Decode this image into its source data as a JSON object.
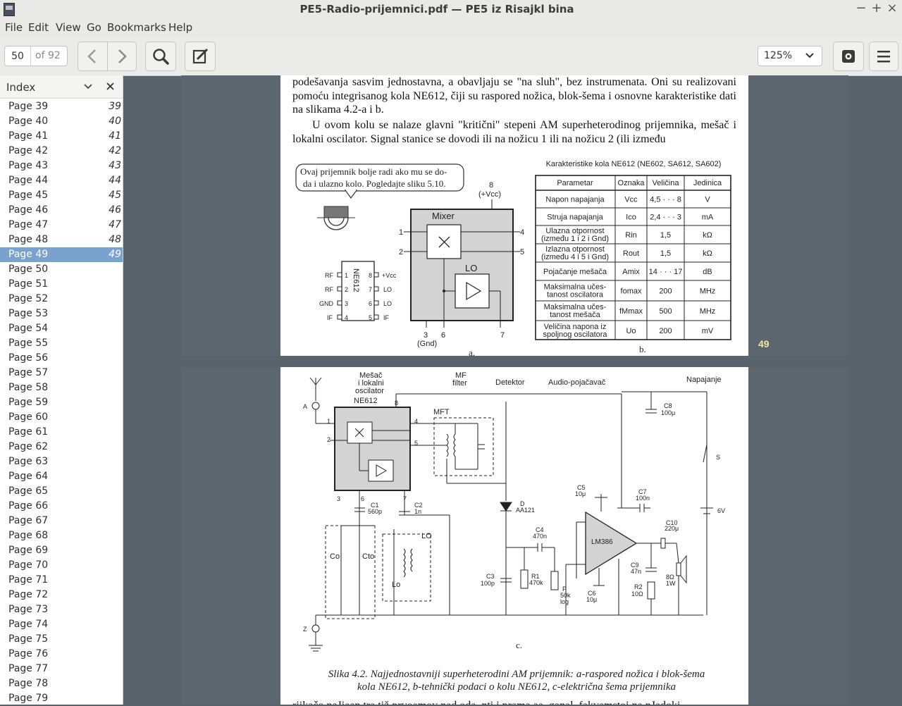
{
  "window": {
    "title": "PE5-Radio-prijemnici.pdf — PE5 iz Risajkl bina",
    "minimize": "−",
    "maximize": "+",
    "close": "×"
  },
  "menu": [
    "File",
    "Edit",
    "View",
    "Go",
    "Bookmarks",
    "Help"
  ],
  "toolbar": {
    "page_value": "50",
    "page_total": "of 92",
    "zoom": "125%"
  },
  "sidebar": {
    "title": "Index",
    "selected": "Page 49",
    "items": [
      {
        "label": "Page 39",
        "num": "39"
      },
      {
        "label": "Page 40",
        "num": "40"
      },
      {
        "label": "Page 41",
        "num": "41"
      },
      {
        "label": "Page 42",
        "num": "42"
      },
      {
        "label": "Page 43",
        "num": "43"
      },
      {
        "label": "Page 44",
        "num": "44"
      },
      {
        "label": "Page 45",
        "num": "45"
      },
      {
        "label": "Page 46",
        "num": "46"
      },
      {
        "label": "Page 47",
        "num": "47"
      },
      {
        "label": "Page 48",
        "num": "48"
      },
      {
        "label": "Page 49",
        "num": "49"
      },
      {
        "label": "Page 50",
        "num": ""
      },
      {
        "label": "Page 51",
        "num": ""
      },
      {
        "label": "Page 52",
        "num": ""
      },
      {
        "label": "Page 53",
        "num": ""
      },
      {
        "label": "Page 54",
        "num": ""
      },
      {
        "label": "Page 55",
        "num": ""
      },
      {
        "label": "Page 56",
        "num": ""
      },
      {
        "label": "Page 57",
        "num": ""
      },
      {
        "label": "Page 58",
        "num": ""
      },
      {
        "label": "Page 59",
        "num": ""
      },
      {
        "label": "Page 60",
        "num": ""
      },
      {
        "label": "Page 61",
        "num": ""
      },
      {
        "label": "Page 62",
        "num": ""
      },
      {
        "label": "Page 63",
        "num": ""
      },
      {
        "label": "Page 64",
        "num": ""
      },
      {
        "label": "Page 65",
        "num": ""
      },
      {
        "label": "Page 66",
        "num": ""
      },
      {
        "label": "Page 67",
        "num": ""
      },
      {
        "label": "Page 68",
        "num": ""
      },
      {
        "label": "Page 69",
        "num": ""
      },
      {
        "label": "Page 70",
        "num": ""
      },
      {
        "label": "Page 71",
        "num": ""
      },
      {
        "label": "Page 72",
        "num": ""
      },
      {
        "label": "Page 73",
        "num": ""
      },
      {
        "label": "Page 74",
        "num": ""
      },
      {
        "label": "Page 75",
        "num": ""
      },
      {
        "label": "Page 76",
        "num": ""
      },
      {
        "label": "Page 77",
        "num": ""
      },
      {
        "label": "Page 78",
        "num": ""
      },
      {
        "label": "Page 79",
        "num": ""
      }
    ]
  },
  "page49": {
    "para1": "podešavanja sasvim jednostavna, a obavljaju se \"na sluh\", bez instrumenata. Oni su realizovani pomoću integrisanog kola NE612, čiji su raspored nožica, blok-šema i osnovne karakteristike dati na slikama 4.2-a i b.",
    "para2": "U ovom kolu se nalaze glavni \"kritični\" stepeni AM superheterodinog prijemnika, mešač i lokalni oscilator. Signal stanice se dovodi ili na nožicu 1 ili na nožicu 2 (ili između",
    "bubble1": "Ovaj prijemnik bolje radi ako mu se do-",
    "bubble2": "da i ulazno kolo. Pogledajte sliku 5.10.",
    "fig_a": {
      "vcc_pin": "8",
      "vcc_label": "(+Vcc)",
      "mixer": "Mixer",
      "lo": "LO",
      "pin1": "1",
      "pin2": "2",
      "pin4": "4",
      "pin5": "5",
      "pin3": "3",
      "pin6": "6",
      "pin7": "7",
      "gnd": "(Gnd)",
      "chip": "NE612",
      "left_labels": [
        "RF",
        "RF",
        "GND",
        "IF"
      ],
      "left_pins": [
        "1",
        "2",
        "3",
        "4"
      ],
      "right_pins": [
        "8",
        "7",
        "6",
        "5"
      ],
      "right_labels": [
        "+Vcc",
        "LO",
        "LO",
        "IF"
      ],
      "label": "a."
    },
    "table": {
      "title": "Karakteristike kola NE612 (NE602, SA612, SA602)",
      "headers": [
        "Parametar",
        "Oznaka",
        "Veličina",
        "Jedinica"
      ],
      "rows": [
        [
          "Napon napajanja",
          "Vcc",
          "4,5 · · · 8",
          "V"
        ],
        [
          "Struja napajanja",
          "Ico",
          "2,4 · · · 3",
          "mA"
        ],
        [
          "Ulazna otpornost\n(između 1 i 2 i Gnd)",
          "Rin",
          "1,5",
          "kΩ"
        ],
        [
          "Izlazna otpornost\n(između 4 i 5 i Gnd)",
          "Rout",
          "1,5",
          "kΩ"
        ],
        [
          "Pojačanje mešača",
          "Amix",
          "14 · · · 17",
          "dB"
        ],
        [
          "Maksimalna učes-\ntanost oscilatora",
          "fomax",
          "200",
          "MHz"
        ],
        [
          "Maksimalna učes-\ntanost mešača",
          "fMmax",
          "500",
          "MHz"
        ],
        [
          "Veličina napona iz\nspoljnog oscilatora",
          "Uo",
          "200",
          "mV"
        ]
      ],
      "label": "b."
    },
    "page_number": "49"
  },
  "page50": {
    "labels": {
      "mesac": [
        "Mešač",
        "i lokalni",
        "oscilator"
      ],
      "chip": "NE612",
      "mf": [
        "MF",
        "filter"
      ],
      "detektor": "Detektor",
      "audio": "Audio-pojačavač",
      "napajanje": "Napajanje",
      "mft": "MFT",
      "lo": "LO",
      "a": "A",
      "z": "Z",
      "c1": [
        "C1",
        "560p"
      ],
      "c2": [
        "C2",
        "1n"
      ],
      "c3": [
        "C3",
        "100p"
      ],
      "c4": [
        "C4",
        "470n"
      ],
      "c5": [
        "C5",
        "10μ"
      ],
      "c6": [
        "C6",
        "10μ"
      ],
      "c7": [
        "C7",
        "100n"
      ],
      "c8": [
        "C8",
        "100μ"
      ],
      "c9": [
        "C9",
        "47n"
      ],
      "c10": [
        "C10",
        "220μ"
      ],
      "r1": [
        "R1",
        "470k"
      ],
      "r2": [
        "R2",
        "10Ω"
      ],
      "p": [
        "P",
        "50k",
        "log"
      ],
      "d": [
        "D",
        "AA121"
      ],
      "lm": "LM386",
      "s": "S",
      "v": "6V",
      "spk": [
        "8Ω",
        "1W"
      ],
      "co": "Co",
      "cto": "Cto",
      "lo_coil": "Lo",
      "fig": "c."
    },
    "caption1": "Slika 4.2. Najjednostavniji superheterodini AM prijemnik: a-raspored nožica i blok-šema",
    "caption2": "kola NE612, b-tehnički podaci o kolu NE612, c-električna šema prijemnika",
    "bottom_text": "riikačo naJiaan tra tiž prvoamov nad oda, nti i prama aa. ganal. fakvamstoi na nJadoki"
  }
}
